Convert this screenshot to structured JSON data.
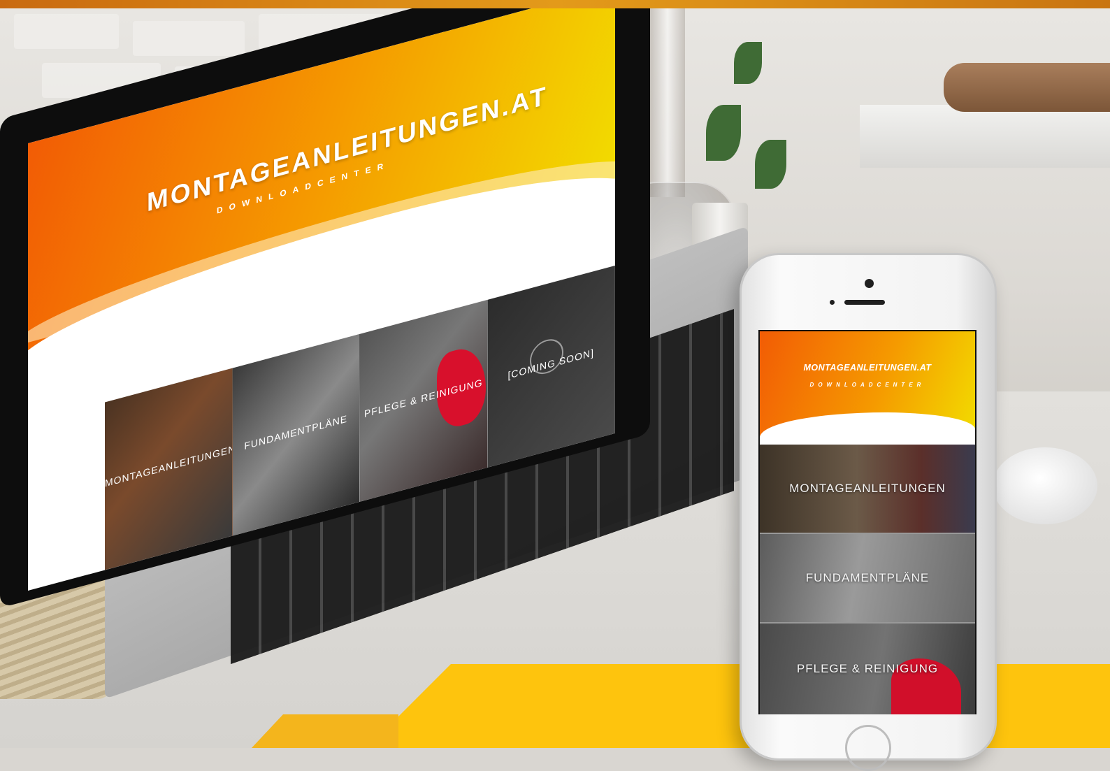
{
  "laptop_site": {
    "title": "MONTAGEANLEITUNGEN.AT",
    "subtitle": "DOWNLOADCENTER",
    "tiles": [
      {
        "label": "MONTAGEANLEITUNGEN"
      },
      {
        "label": "FUNDAMENTPLÄNE"
      },
      {
        "label": "PFLEGE & REINIGUNG"
      },
      {
        "label": "[COMING SOON]"
      }
    ]
  },
  "phone_site": {
    "title": "MONTAGEANLEITUNGEN.AT",
    "subtitle": "DOWNLOADCENTER",
    "tiles": [
      {
        "label": "MONTAGEANLEITUNGEN"
      },
      {
        "label": "FUNDAMENTPLÄNE"
      },
      {
        "label": "PFLEGE & REINIGUNG"
      }
    ]
  },
  "colors": {
    "header_orange": "#f25c05",
    "header_yellow": "#f2dd00",
    "accent_yellow": "#fec40d",
    "top_bar": "#d98a16"
  }
}
